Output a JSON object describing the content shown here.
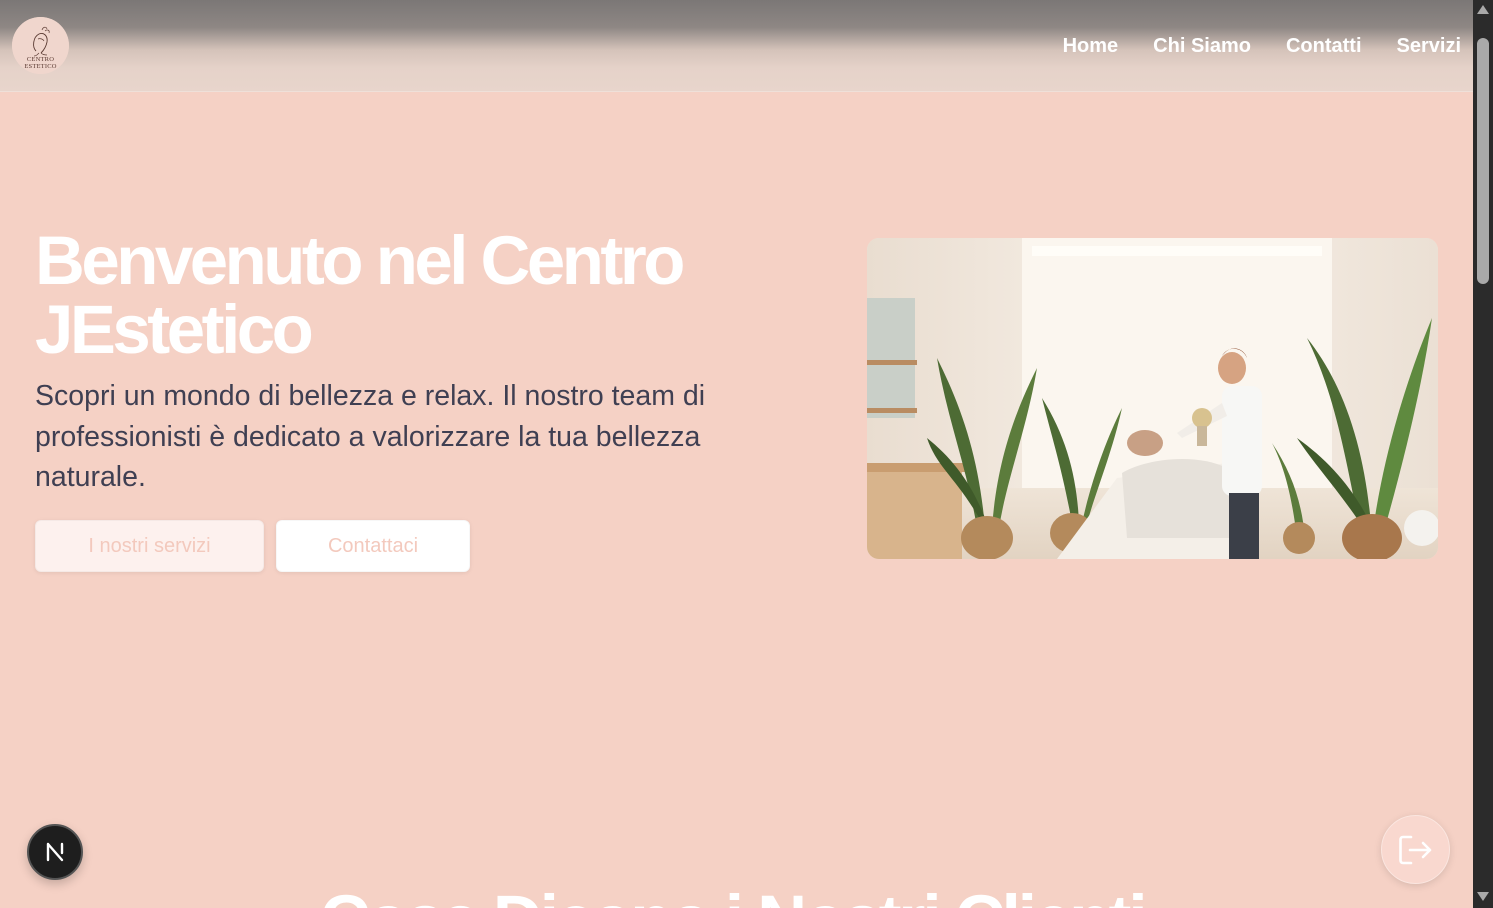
{
  "header": {
    "logo_line1": "CENTRO",
    "logo_line2": "ESTETICO",
    "nav": [
      {
        "label": "Home"
      },
      {
        "label": "Chi Siamo"
      },
      {
        "label": "Contatti"
      },
      {
        "label": "Servizi"
      }
    ]
  },
  "hero": {
    "title": "Benvenuto nel Centro JEstetico",
    "description": "Scopri un mondo di bellezza e relax. Il nostro team di professionisti è dedicato a valorizzare la tua bellezza naturale.",
    "buttons": {
      "services": "I nostri servizi",
      "contact": "Contattaci"
    },
    "image_icon": "spa-treatment-photo"
  },
  "next_section": {
    "heading": "Cosa Dicono i Nostri Clienti"
  },
  "floating": {
    "next_badge_letter": "N",
    "logout_icon": "logout-icon"
  },
  "colors": {
    "background": "#f5d1c5",
    "title": "#ffffff",
    "text": "#3f3f52",
    "button_text": "#f3c9bd"
  }
}
